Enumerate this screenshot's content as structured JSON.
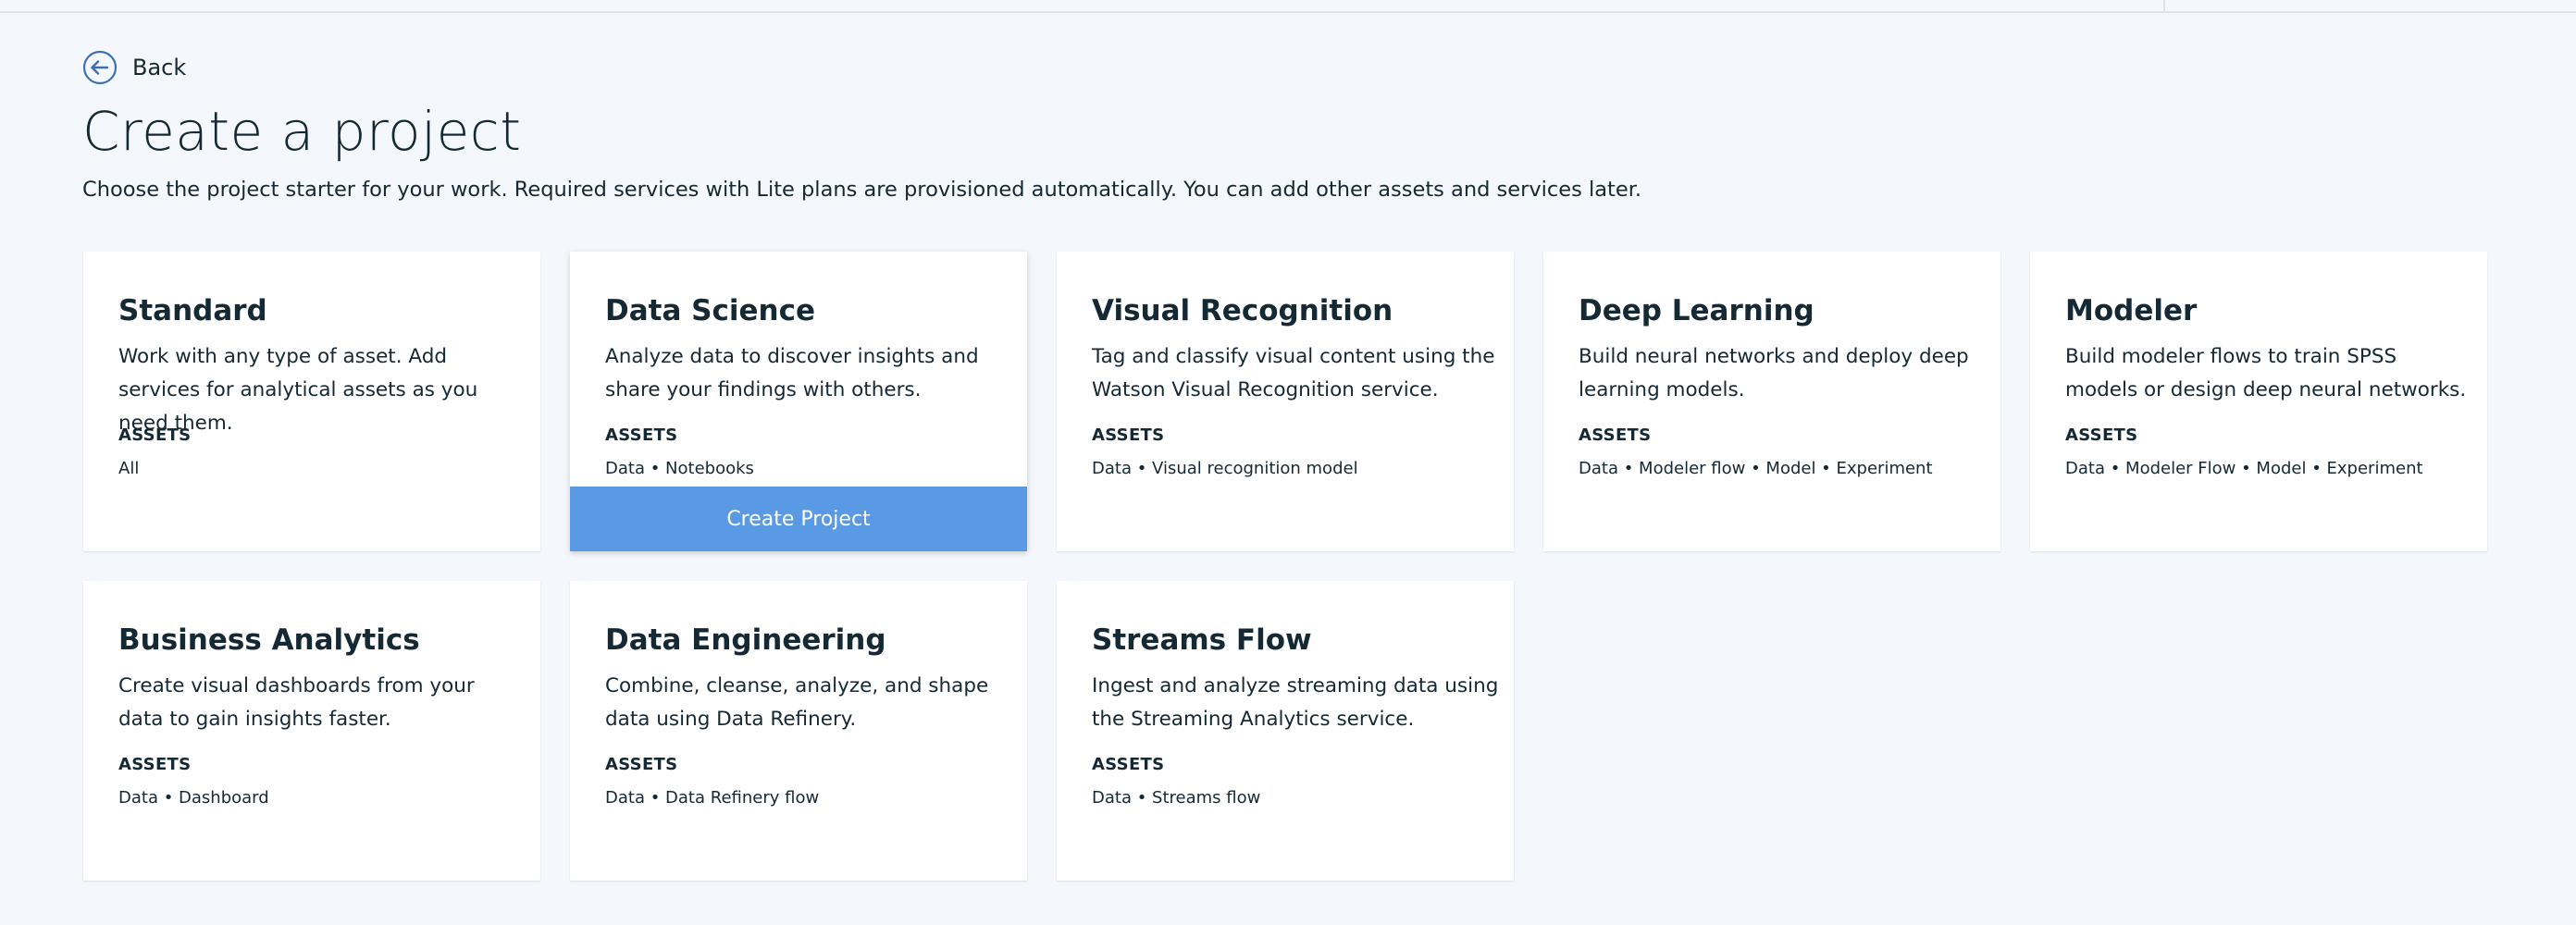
{
  "header": {
    "back_label": "Back",
    "title": "Create a project",
    "description": "Choose the project starter for your work. Required services with Lite plans are provisioned automatically. You can add other assets and services later."
  },
  "assets_label": "ASSETS",
  "create_button_label": "Create Project",
  "cards": [
    {
      "title": "Standard",
      "description": "Work with any type of asset. Add services for analytical assets as you need them.",
      "assets": "All"
    },
    {
      "title": "Data Science",
      "description": "Analyze data to discover insights and share your findings with others.",
      "assets": "Data • Notebooks",
      "hovered": true
    },
    {
      "title": "Visual Recognition",
      "description": "Tag and classify visual content using the Watson Visual Recognition service.",
      "assets": "Data • Visual recognition model"
    },
    {
      "title": "Deep Learning",
      "description": "Build neural networks and deploy deep learning models.",
      "assets": "Data • Modeler flow • Model • Experiment"
    },
    {
      "title": "Modeler",
      "description": "Build modeler flows to train SPSS models or design deep neural networks.",
      "assets": "Data • Modeler Flow • Model • Experiment"
    },
    {
      "title": "Business Analytics",
      "description": "Create visual dashboards from your data to gain insights faster.",
      "assets": "Data • Dashboard"
    },
    {
      "title": "Data Engineering",
      "description": "Combine, cleanse, analyze, and shape data using Data Refinery.",
      "assets": "Data • Data Refinery flow"
    },
    {
      "title": "Streams Flow",
      "description": "Ingest and analyze streaming data using the Streaming Analytics service.",
      "assets": "Data • Streams flow"
    }
  ],
  "colors": {
    "page_background": "#f4f7fb",
    "card_background": "#ffffff",
    "text": "#152935",
    "accent_blue": "#5a9ae5",
    "back_icon": "#3d70b2"
  },
  "icons": {
    "back": "arrow-left-circle-icon"
  }
}
